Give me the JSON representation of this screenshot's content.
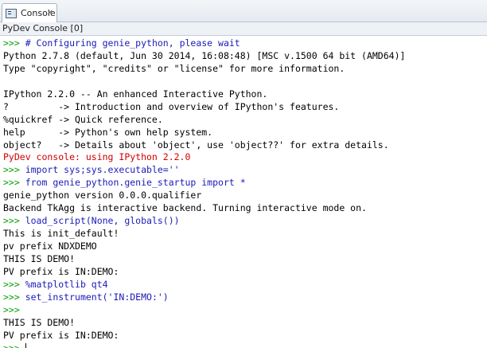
{
  "tab": {
    "label": "Console",
    "icon": "console-icon",
    "close_glyph": "✕"
  },
  "console_title": "PyDev Console [0]",
  "colors": {
    "prompt": "#00a000",
    "command": "#1a1ab8",
    "output": "#000000",
    "error": "#d00000"
  },
  "lines": [
    {
      "type": "cmd",
      "prompt": ">>> ",
      "text": "# Configuring genie_python, please wait"
    },
    {
      "type": "out",
      "text": "Python 2.7.8 (default, Jun 30 2014, 16:08:48) [MSC v.1500 64 bit (AMD64)]"
    },
    {
      "type": "out",
      "text": "Type \"copyright\", \"credits\" or \"license\" for more information."
    },
    {
      "type": "out",
      "text": ""
    },
    {
      "type": "out",
      "text": "IPython 2.2.0 -- An enhanced Interactive Python."
    },
    {
      "type": "out",
      "text": "?         -> Introduction and overview of IPython's features."
    },
    {
      "type": "out",
      "text": "%quickref -> Quick reference."
    },
    {
      "type": "out",
      "text": "help      -> Python's own help system."
    },
    {
      "type": "out",
      "text": "object?   -> Details about 'object', use 'object??' for extra details."
    },
    {
      "type": "err",
      "text": "PyDev console: using IPython 2.2.0"
    },
    {
      "type": "cmd",
      "prompt": ">>> ",
      "text": "import sys;sys.executable=''"
    },
    {
      "type": "cmd",
      "prompt": ">>> ",
      "text": "from genie_python.genie_startup import *"
    },
    {
      "type": "out",
      "text": "genie_python version 0.0.0.qualifier"
    },
    {
      "type": "out",
      "text": "Backend TkAgg is interactive backend. Turning interactive mode on."
    },
    {
      "type": "cmd",
      "prompt": ">>> ",
      "text": "load_script(None, globals())"
    },
    {
      "type": "out",
      "text": "This is init_default!"
    },
    {
      "type": "out",
      "text": "pv prefix NDXDEMO"
    },
    {
      "type": "out",
      "text": "THIS IS DEMO!"
    },
    {
      "type": "out",
      "text": "PV prefix is IN:DEMO:"
    },
    {
      "type": "cmd",
      "prompt": ">>> ",
      "text": "%matplotlib qt4"
    },
    {
      "type": "cmd",
      "prompt": ">>> ",
      "text": "set_instrument('IN:DEMO:')"
    },
    {
      "type": "cmd",
      "prompt": ">>> ",
      "text": ""
    },
    {
      "type": "out",
      "text": "THIS IS DEMO!"
    },
    {
      "type": "out",
      "text": "PV prefix is IN:DEMO:"
    },
    {
      "type": "input",
      "prompt": ">>> ",
      "text": ""
    }
  ]
}
